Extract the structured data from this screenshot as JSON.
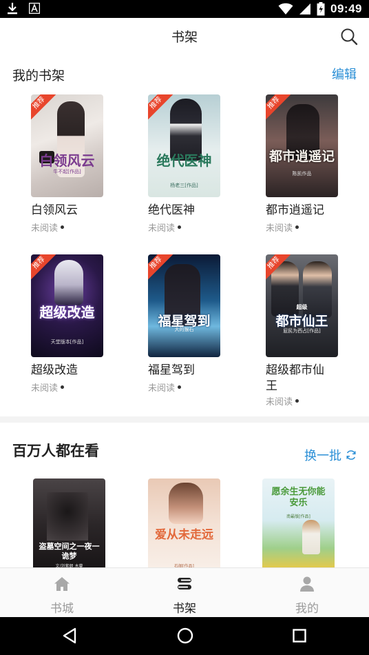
{
  "status_bar": {
    "time": "09:49",
    "icons": [
      "download-icon",
      "a-notification-icon",
      "wifi-icon",
      "signal-icon",
      "battery-icon"
    ]
  },
  "app_bar": {
    "title": "书架",
    "search_icon": "search-icon"
  },
  "bookshelf": {
    "title": "我的书架",
    "edit_label": "编辑",
    "badge_label": "推荐",
    "status_label": "未阅读",
    "books": [
      {
        "name": "白领风云",
        "cover_title": "白领风云",
        "cover_sub": "牛不起[作品]"
      },
      {
        "name": "绝代医神",
        "cover_title": "绝代医神",
        "cover_sub": "杨老三[作品]"
      },
      {
        "name": "都市逍遥记",
        "cover_title": "都市逍遥记",
        "cover_sub": "陈凯作品"
      },
      {
        "name": "超级改造",
        "cover_title": "超级改造",
        "cover_sub": "天堂版本[作品]"
      },
      {
        "name": "福星驾到",
        "cover_title": "福星驾到",
        "cover_sub": "大的猴石"
      },
      {
        "name": "超级都市仙王",
        "cover_title": "都市仙王",
        "cover_badge": "超级",
        "cover_sub": "屁民为西占[作品]"
      }
    ]
  },
  "recommend": {
    "title": "百万人都在看",
    "refresh_label": "换一批",
    "books": [
      {
        "cover_title": "盗墓空间之一夜一诡梦",
        "cover_sub": "文/刘紫朗 木蔓"
      },
      {
        "cover_title": "爱从未走远",
        "cover_sub": "石阁[作品]"
      },
      {
        "cover_title": "愿余生无你能安乐",
        "cover_sub": "南最版[作品]"
      }
    ]
  },
  "bottom_nav": {
    "items": [
      {
        "label": "书城",
        "icon": "home-icon"
      },
      {
        "label": "书架",
        "icon": "bookshelf-icon"
      },
      {
        "label": "我的",
        "icon": "person-icon"
      }
    ],
    "active_index": 1
  },
  "colors": {
    "accent": "#2b8fd6",
    "badge": "#e8452c",
    "text": "#222222",
    "muted": "#999999"
  }
}
